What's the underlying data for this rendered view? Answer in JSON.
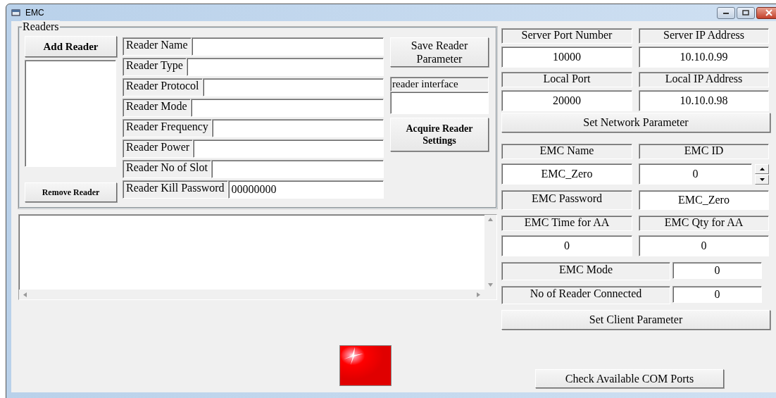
{
  "window": {
    "title": "EMC"
  },
  "readers": {
    "title": "Readers",
    "add_button": "Add Reader",
    "remove_button": "Remove Reader",
    "fields": [
      {
        "label": "Reader Name"
      },
      {
        "label": "Reader Type"
      },
      {
        "label": "Reader Protocol"
      },
      {
        "label": "Reader Mode"
      },
      {
        "label": "Reader Frequency"
      },
      {
        "label": "Reader Power"
      },
      {
        "label": "Reader No of Slot"
      },
      {
        "label": "Reader Kill Password",
        "value": "00000000"
      }
    ],
    "save_button": "Save Reader Parameter",
    "interface": {
      "label": "reader interface"
    },
    "acquire_button": "Acquire Reader Settings"
  },
  "network": {
    "fields": [
      {
        "label": "Server Port Number",
        "value": "10000"
      },
      {
        "label": "Server IP Address",
        "value": "10.10.0.99"
      },
      {
        "label": "Local Port",
        "value": "20000"
      },
      {
        "label": "Local IP Address",
        "value": "10.10.0.98"
      }
    ],
    "button": "Set Network Parameter"
  },
  "client": {
    "rows": [
      {
        "kind": "columns",
        "fields": [
          {
            "label": "EMC Name",
            "value": "EMC_Zero",
            "kind": "text"
          },
          {
            "label": "EMC ID",
            "value": "0",
            "kind": "spinner"
          }
        ]
      },
      {
        "kind": "pair",
        "label": "EMC Password",
        "value": "EMC_Zero"
      },
      {
        "kind": "columns",
        "fields": [
          {
            "label": "EMC Time for AA",
            "value": "0",
            "kind": "text"
          },
          {
            "label": "EMC Qty for AA",
            "value": "0",
            "kind": "text"
          }
        ]
      },
      {
        "kind": "inline",
        "label": "EMC Mode",
        "value": "0"
      },
      {
        "kind": "inline",
        "label": "No of Reader Connected",
        "value": "0"
      }
    ],
    "button": "Set Client Parameter"
  },
  "com_button": "Check Available COM Ports"
}
